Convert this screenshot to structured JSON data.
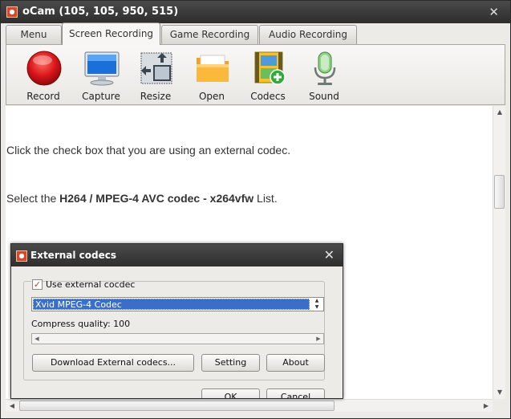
{
  "window": {
    "title": "oCam (105, 105, 950, 515)",
    "app_icon_glyph": "●"
  },
  "tabs": [
    {
      "label": "Menu"
    },
    {
      "label": "Screen Recording",
      "active": true
    },
    {
      "label": "Game Recording"
    },
    {
      "label": "Audio Recording"
    }
  ],
  "toolbar": [
    {
      "label": "Record",
      "icon": "record-icon"
    },
    {
      "label": "Capture",
      "icon": "monitor-icon"
    },
    {
      "label": "Resize",
      "icon": "resize-icon"
    },
    {
      "label": "Open",
      "icon": "folder-icon"
    },
    {
      "label": "Codecs",
      "icon": "codecs-icon"
    },
    {
      "label": "Sound",
      "icon": "microphone-icon"
    }
  ],
  "content": {
    "line1": "Click the check box that you are using an external codec.",
    "line2_prefix": "Select the ",
    "line2_bold": "H264 / MPEG-4 AVC codec - x264vfw",
    "line2_suffix": " List."
  },
  "dialog": {
    "title": "External codecs",
    "use_external_label": "Use external cocdec",
    "use_external_checked": true,
    "codec_selected": "Xvid MPEG-4 Codec",
    "compress_quality_label": "Compress quality: 100",
    "buttons": {
      "download": "Download External codecs...",
      "setting": "Setting",
      "about": "About",
      "ok": "OK",
      "cancel": "Cancel"
    }
  },
  "colors": {
    "record_red": "#d8141a",
    "selection_blue": "#3a6ec7",
    "titlebar": "#3a3a3a"
  }
}
